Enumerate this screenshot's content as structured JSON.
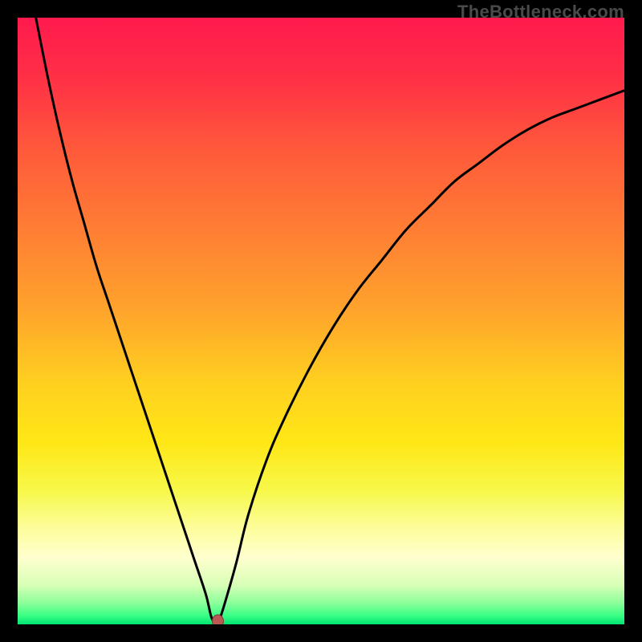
{
  "watermark": "TheBottleneck.com",
  "colors": {
    "frame": "#000000",
    "curve": "#000000",
    "marker_fill": "#b85a52",
    "marker_stroke": "#7a3a35"
  },
  "gradient_stops": [
    {
      "offset": 0.0,
      "color": "#ff1a4d"
    },
    {
      "offset": 0.1,
      "color": "#ff3046"
    },
    {
      "offset": 0.22,
      "color": "#ff5a3a"
    },
    {
      "offset": 0.35,
      "color": "#ff7e34"
    },
    {
      "offset": 0.48,
      "color": "#ffa32c"
    },
    {
      "offset": 0.6,
      "color": "#ffcf20"
    },
    {
      "offset": 0.7,
      "color": "#ffe716"
    },
    {
      "offset": 0.78,
      "color": "#f7f84a"
    },
    {
      "offset": 0.84,
      "color": "#fdfd9a"
    },
    {
      "offset": 0.89,
      "color": "#ffffcf"
    },
    {
      "offset": 0.935,
      "color": "#d8ffb6"
    },
    {
      "offset": 0.965,
      "color": "#8cff9a"
    },
    {
      "offset": 0.985,
      "color": "#3cff86"
    },
    {
      "offset": 1.0,
      "color": "#00e572"
    }
  ],
  "chart_data": {
    "type": "line",
    "title": "",
    "xlabel": "",
    "ylabel": "",
    "xlim": [
      0,
      100
    ],
    "ylim": [
      0,
      100
    ],
    "grid": false,
    "legend": false,
    "annotations": [],
    "marker": {
      "x": 33,
      "y": 0
    },
    "series": [
      {
        "name": "left",
        "x": [
          3,
          5,
          7,
          9,
          11,
          13,
          15,
          17,
          19,
          21,
          23,
          25,
          27,
          29,
          31,
          32,
          33
        ],
        "values": [
          100,
          90,
          81,
          73,
          66,
          59,
          53,
          47,
          41,
          35,
          29,
          23,
          17,
          11,
          5,
          1,
          0
        ]
      },
      {
        "name": "right",
        "x": [
          33,
          34,
          36,
          38,
          41,
          44,
          48,
          52,
          56,
          60,
          64,
          68,
          72,
          76,
          80,
          84,
          88,
          92,
          96,
          100
        ],
        "values": [
          0,
          3,
          10,
          18,
          27,
          34,
          42,
          49,
          55,
          60,
          65,
          69,
          73,
          76,
          79,
          81.5,
          83.5,
          85,
          86.5,
          88
        ]
      }
    ]
  }
}
